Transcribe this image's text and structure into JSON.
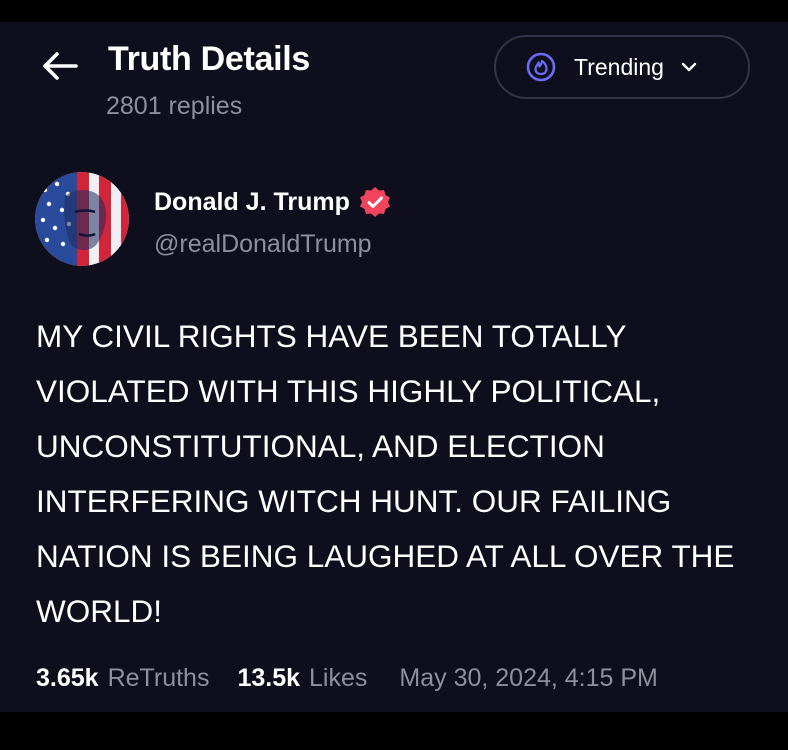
{
  "header": {
    "title": "Truth Details",
    "replies": "2801 replies",
    "back_icon": "arrow-left-icon",
    "sort": {
      "label": "Trending",
      "icon": "fire-icon",
      "dropdown_icon": "chevron-down-icon"
    }
  },
  "post": {
    "author": {
      "name": "Donald J. Trump",
      "handle": "@realDonaldTrump",
      "verified_icon": "verified-badge-icon",
      "avatar": "flag-portrait-avatar"
    },
    "text": "MY CIVIL RIGHTS HAVE BEEN TOTALLY VIOLATED WITH THIS HIGHLY POLITICAL, UNCONSTITUTIONAL, AND ELECTION INTERFERING WITCH HUNT. OUR FAILING NATION IS BEING LAUGHED AT ALL OVER THE WORLD!",
    "stats": {
      "retruths_count": "3.65k",
      "retruths_label": "ReTruths",
      "likes_count": "13.5k",
      "likes_label": "Likes",
      "timestamp": "May 30, 2024, 4:15 PM"
    }
  },
  "colors": {
    "background": "#0f0e1c",
    "text_primary": "#ffffff",
    "text_secondary": "#8f8f9c",
    "accent": "#6a6cf6",
    "verified": "#f2435c"
  }
}
